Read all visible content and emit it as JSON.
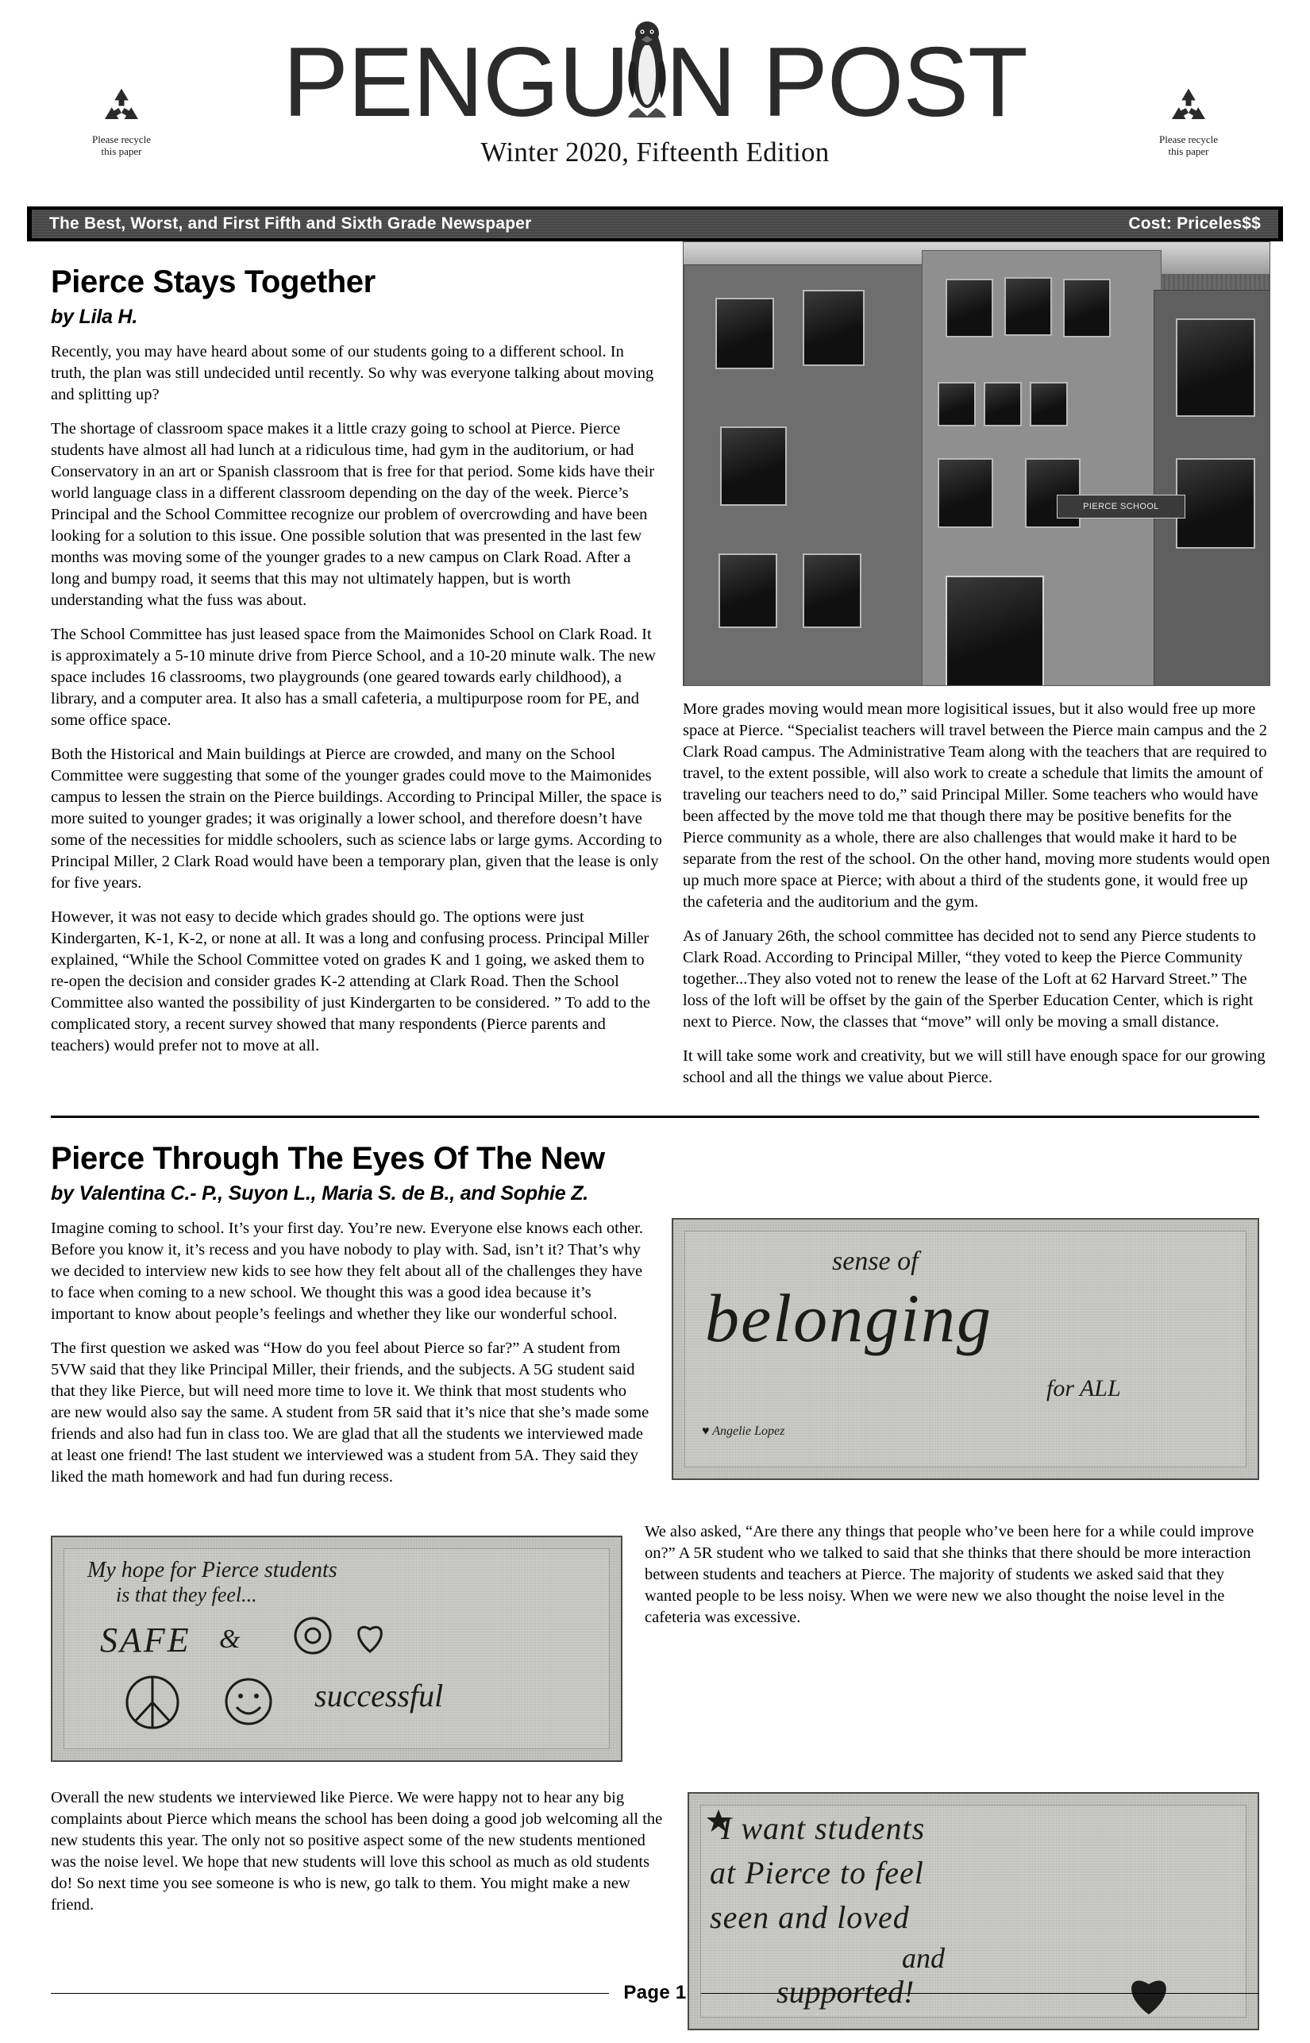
{
  "masthead": {
    "title_part1": "PENGU",
    "title_part2": "N POST",
    "penguin_icon": "penguin-icon",
    "subtitle": "Winter 2020, Fifteenth Edition",
    "recycle_left": {
      "icon": "recycle-icon",
      "line1": "Please recycle",
      "line2": "this paper"
    },
    "recycle_right": {
      "icon": "recycle-icon",
      "line1": "Please recycle",
      "line2": "this paper"
    }
  },
  "banner": {
    "tagline": "The Best, Worst, and First Fifth and Sixth Grade Newspaper",
    "cost": "Cost:  Priceles$$"
  },
  "articles": [
    {
      "headline": "Pierce Stays Together",
      "byline": "by Lila H.",
      "photo": {
        "name": "school-building-photo",
        "sign_text": "PIERCE SCHOOL"
      },
      "left_paragraphs": [
        "Recently, you may have heard about some of our students going to a different school. In truth, the plan was still undecided until recently. So why was everyone talking about moving and splitting up?",
        "The shortage of classroom space makes it a little crazy going to school at Pierce. Pierce students have almost all had lunch at a ridiculous time, had gym in the auditorium, or had Conservatory in an art or Spanish classroom that is free for that period.  Some kids have their world language class in a different classroom depending on the day of the week.  Pierce’s Principal and the School Committee recognize our problem of overcrowding and have been looking for a solution to this issue.  One possible solution that was presented in the last few months was moving some of the younger grades to a new campus on Clark Road. After a long and bumpy road, it seems that this may not ultimately happen, but is worth understanding what the fuss was about.",
        "The School Committee has just leased  space from the Maimonides School on Clark Road. It is approximately a 5-10 minute drive from Pierce School, and a 10-20 minute walk.  The new space includes 16 classrooms, two playgrounds (one geared towards early childhood), a library, and a computer area. It also has a small cafeteria, a multipurpose room for PE, and some office space.",
        "Both the Historical and Main buildings at Pierce are crowded, and many on the School Committee were suggesting that some of the younger grades  could move to the Maimonides campus to lessen the strain on the Pierce buildings. According to Principal Miller, the space is more suited to younger grades; it was originally a lower school, and therefore doesn’t have some of the necessities for middle schoolers, such as science labs or large gyms. According to Principal Miller, 2 Clark Road would have been a temporary plan, given that the lease is only for five years.",
        "However, it was not easy to decide  which grades should go. The options were  just Kindergarten, K-1, K-2, or none at all. It was a long and confusing process. Principal Miller explained, “While the School Committee voted on grades K and 1 going, we asked them to re-open the decision and consider grades K-2 attending at Clark Road. Then the School Committee also wanted the possibility of just Kindergarten to be considered. ”  To add to the complicated story, a recent survey showed that many respondents (Pierce parents and teachers) would prefer not to move at all."
      ],
      "right_paragraphs": [
        "More grades moving would mean more logisitical issues, but it also would free up more space at Pierce. “Specialist teachers will travel between the Pierce main campus and the 2 Clark Road campus. The Administrative Team along with the teachers that are required to travel, to the extent possible,  will also work to create a schedule that limits the amount of traveling our teachers need to do,” said Principal Miller. Some teachers who would have been affected by the move told me that though there may be positive benefits for the Pierce community as a whole, there are also challenges that would make it hard to be separate from the rest of the school. On the other hand, moving more students would open up much more space at Pierce; with about a third of the students gone,  it would free up the cafeteria and the auditorium  and the gym.",
        "As of January 26th, the school committee has decided not to send any Pierce students to Clark Road. According to Principal Miller, “they voted to keep the Pierce Community together...They also voted not to renew the lease of the Loft at 62 Harvard Street.” The loss of the loft will be offset by the gain of the Sperber Education Center, which is right next to Pierce. Now, the classes that “move” will only be moving a small distance.",
        " It will take some work and creativity, but we will still have enough space for our growing school and all the things we value about Pierce."
      ]
    },
    {
      "headline": "Pierce Through The Eyes Of The New",
      "byline": "by Valentina C.- P., Suyon L., Maria S. de B., and Sophie Z.",
      "paragraphs": [
        "Imagine coming to school. It’s your first day. You’re new. Everyone else knows each other. Before you know it, it’s recess and you have nobody to play with. Sad, isn’t it? That’s why we decided to interview new kids to see how they felt about all of the challenges they have to face when coming to a new school. We thought this was a good idea because it’s important to know about people’s feelings and whether they like our wonderful school.",
        "The first question we asked was “How do you feel about Pierce so far?”  A student from 5VW said that they like Principal Miller, their friends, and the subjects. A 5G student said that they like Pierce, but will need more time to love it. We think that most students who are new would also say the same. A student from 5R said that it’s nice that she’s made some friends and also had fun in class too. We are glad that all the students we interviewed made at least one friend! The last student we interviewed was a student from 5A. They said they liked the math homework and had fun during recess.",
        "We also asked, “Are there any things that people who’ve been here for a while could improve on?” A 5R student who we talked to said that she thinks that there should be more interaction between students and teachers at Pierce. The majority of students we asked said that they wanted people to be less noisy. When we were new we also thought the noise level in the cafeteria was excessive.",
        "Overall the new students we interviewed like Pierce. We were happy not to hear any big complaints about Pierce which means the school has been doing a good job welcoming all the new students this year. The only not so positive aspect some of the new students mentioned was the noise level. We hope that new students will love this school as much as old students do! So next time you see someone is who is new, go talk to them. You might make a new friend."
      ],
      "posters": [
        {
          "name": "poster-sense-of-belonging",
          "line1": "sense of",
          "line2": "belonging",
          "line3": "for ALL",
          "credit": "♥ Angelie Lopez"
        },
        {
          "name": "poster-my-hope-for-pierce",
          "line1": "My hope for Pierce students",
          "line2": "is that they feel...",
          "line3": "SAFE",
          "line4": "& ",
          "line5": "successful"
        },
        {
          "name": "poster-i-want-students",
          "line1": "I want students",
          "line2": "at Pierce to feel",
          "line3": "seen and loved",
          "line4": "and",
          "line5": "supported!"
        }
      ]
    }
  ],
  "footer": {
    "page_label": "Page 1"
  }
}
